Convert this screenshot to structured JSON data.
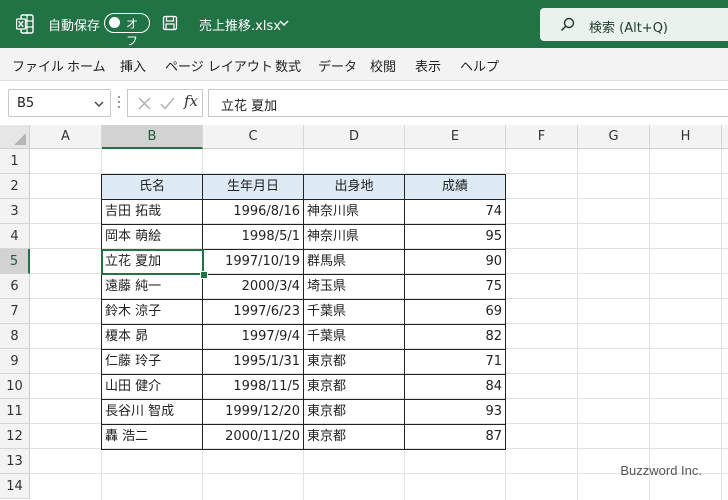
{
  "titlebar": {
    "autosave_label": "自動保存",
    "autosave_state": "オフ",
    "filename": "売上推移.xlsx",
    "search_placeholder": "検索 (Alt+Q)",
    "bg_color": "#217346"
  },
  "menu": [
    "ファイル",
    "ホーム",
    "挿入",
    "ページ レイアウト",
    "数式",
    "データ",
    "校閲",
    "表示",
    "ヘルプ"
  ],
  "formula_bar": {
    "name_box": "B5",
    "fx_label": "fx",
    "content": "立花 夏加"
  },
  "grid": {
    "columns": [
      "A",
      "B",
      "C",
      "D",
      "E",
      "F",
      "G",
      "H"
    ],
    "rows": [
      "1",
      "2",
      "3",
      "4",
      "5",
      "6",
      "7",
      "8",
      "9",
      "10",
      "11",
      "12",
      "13",
      "14"
    ],
    "selected_column": "B",
    "selected_row": "5"
  },
  "table": {
    "headers": [
      "氏名",
      "生年月日",
      "出身地",
      "成績"
    ],
    "rows": [
      [
        "吉田 拓哉",
        "1996/8/16",
        "神奈川県",
        "74"
      ],
      [
        "岡本 萌絵",
        "1998/5/1",
        "神奈川県",
        "95"
      ],
      [
        "立花 夏加",
        "1997/10/19",
        "群馬県",
        "90"
      ],
      [
        "遠藤 純一",
        "2000/3/4",
        "埼玉県",
        "75"
      ],
      [
        "鈴木 涼子",
        "1997/6/23",
        "千葉県",
        "69"
      ],
      [
        "榎本 昴",
        "1997/9/4",
        "千葉県",
        "82"
      ],
      [
        "仁藤 玲子",
        "1995/1/31",
        "東京都",
        "71"
      ],
      [
        "山田 健介",
        "1998/11/5",
        "東京都",
        "84"
      ],
      [
        "長谷川 智成",
        "1999/12/20",
        "東京都",
        "93"
      ],
      [
        "轟 浩二",
        "2000/11/20",
        "東京都",
        "87"
      ]
    ],
    "header_fill": "#dde9f5"
  },
  "watermark": "Buzzword Inc."
}
